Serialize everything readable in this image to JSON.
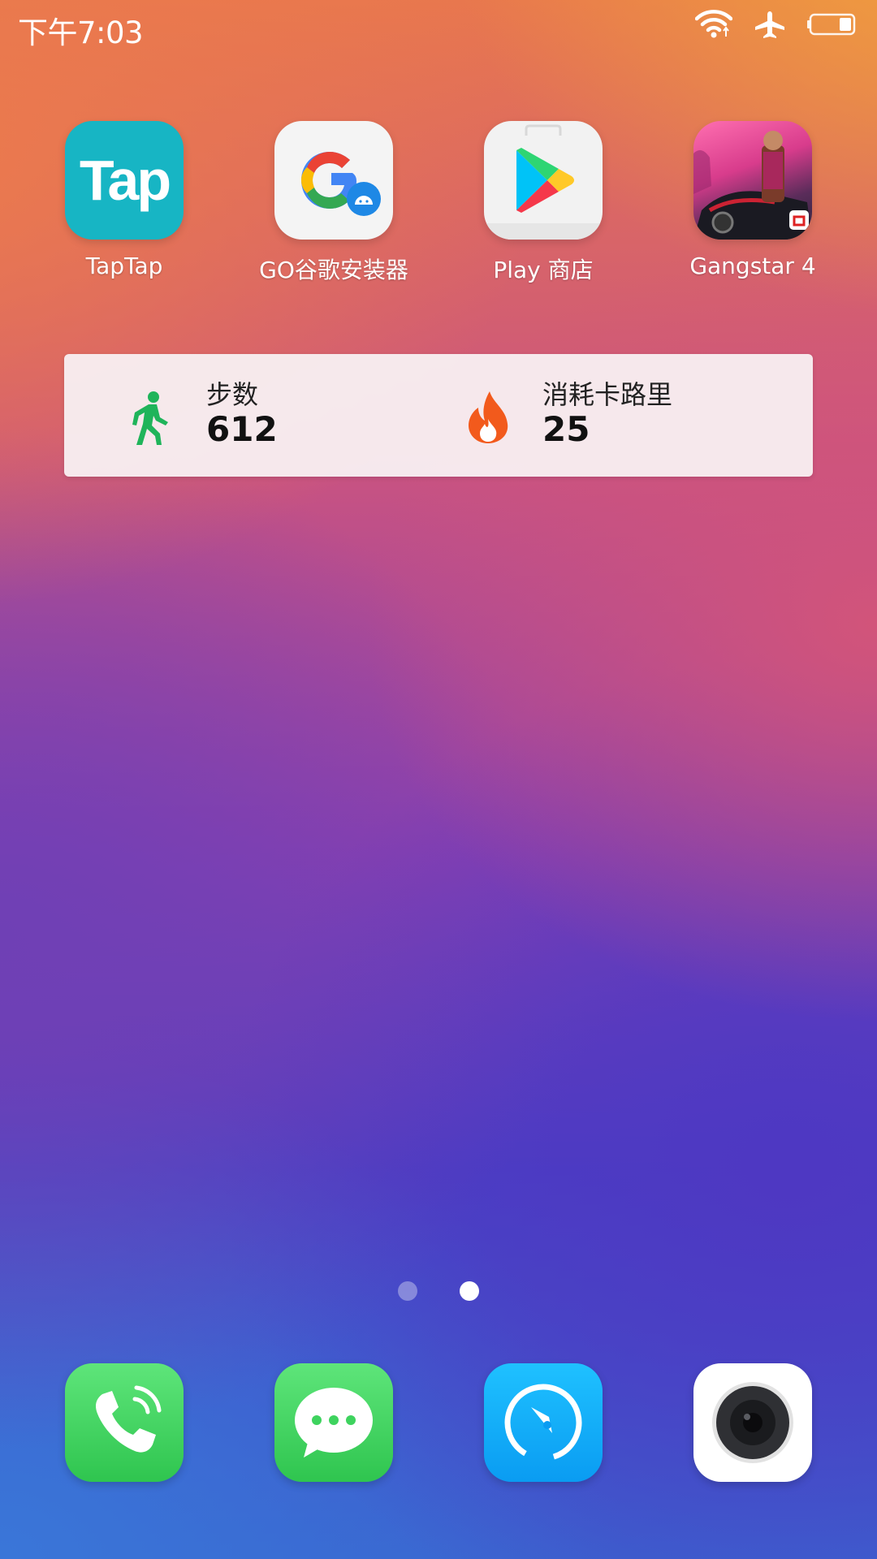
{
  "status_bar": {
    "time": "下午7:03",
    "icons": [
      "wifi-icon",
      "airplane-mode-icon",
      "battery-icon"
    ],
    "battery_level": 0.3
  },
  "apps": [
    {
      "label": "TapTap",
      "icon": "taptap-icon",
      "logo_text": "Tap"
    },
    {
      "label": "GO谷歌安装器",
      "icon": "go-google-installer-icon"
    },
    {
      "label": "Play 商店",
      "icon": "play-store-icon"
    },
    {
      "label": "Gangstar 4",
      "icon": "gangstar-icon"
    }
  ],
  "widget": {
    "steps_label": "步数",
    "steps_value": "612",
    "calories_label": "消耗卡路里",
    "calories_value": "25",
    "steps_color": "#1fb45a",
    "calories_color": "#f25a1c"
  },
  "page_indicator": {
    "pages": 2,
    "current": 2
  },
  "dock": [
    {
      "icon": "phone-icon",
      "color": "#3ed35e"
    },
    {
      "icon": "messages-icon",
      "color": "#3ed35e"
    },
    {
      "icon": "browser-icon",
      "color": "#13a8f7"
    },
    {
      "icon": "camera-icon",
      "color": "#ffffff"
    }
  ]
}
